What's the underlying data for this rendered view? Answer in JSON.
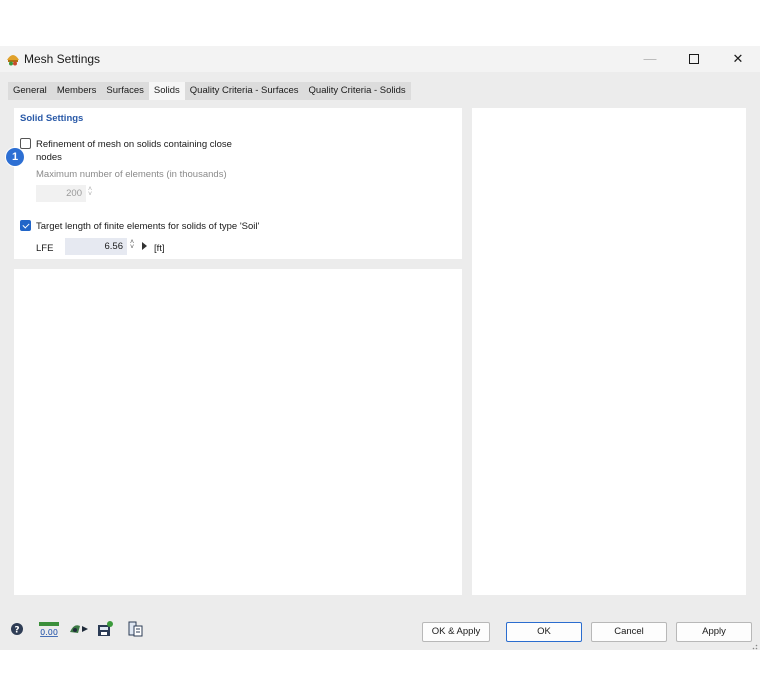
{
  "window": {
    "title": "Mesh Settings",
    "minimize_glyph": "—",
    "close_glyph": "✕"
  },
  "tabs": [
    {
      "label": "General",
      "active": false
    },
    {
      "label": "Members",
      "active": false
    },
    {
      "label": "Surfaces",
      "active": false
    },
    {
      "label": "Solids",
      "active": true
    },
    {
      "label": "Quality Criteria - Surfaces",
      "active": false
    },
    {
      "label": "Quality Criteria - Solids",
      "active": false
    }
  ],
  "solid_settings": {
    "title": "Solid Settings",
    "refinement": {
      "checked": false,
      "label_line1": "Refinement of mesh on solids containing close",
      "label_line2": "nodes"
    },
    "max_elements": {
      "label": "Maximum number of elements (in thousands)",
      "value": "200",
      "enabled": false
    },
    "target_length": {
      "checked": true,
      "label": "Target length of finite elements for solids of type 'Soil'"
    },
    "lfe": {
      "label": "LFE",
      "value": "6.56",
      "unit": "[ft]"
    }
  },
  "callout_badge": "1",
  "buttons": {
    "ok_apply": "OK & Apply",
    "ok": "OK",
    "cancel": "Cancel",
    "apply": "Apply"
  },
  "toolbar_icons": [
    "help-icon",
    "decimal-places-icon",
    "units-icon",
    "save-template-icon",
    "load-template-icon"
  ],
  "toolbar_decimal_text": "0.00",
  "colors": {
    "accent": "#2165c8",
    "section_title": "#2a5aa8",
    "badge": "#2d6fd3"
  }
}
